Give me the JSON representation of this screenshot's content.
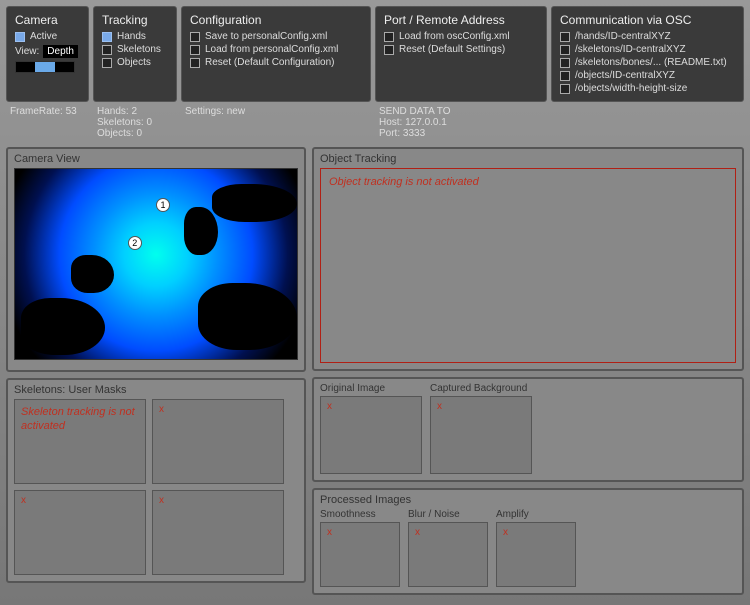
{
  "camera": {
    "title": "Camera",
    "active_label": "Active",
    "view_label": "View:",
    "view_value": "Depth",
    "framerate_label": "FrameRate:",
    "framerate_value": "53"
  },
  "tracking": {
    "title": "Tracking",
    "hands_label": "Hands",
    "skeletons_label": "Skeletons",
    "objects_label": "Objects",
    "hands_count_label": "Hands:",
    "hands_count": "2",
    "skeletons_count_label": "Skeletons:",
    "skeletons_count": "0",
    "objects_count_label": "Objects:",
    "objects_count": "0"
  },
  "configuration": {
    "title": "Configuration",
    "save_label": "Save to personalConfig.xml",
    "load_label": "Load from personalConfig.xml",
    "reset_label": "Reset (Default Configuration)",
    "settings_label": "Settings:",
    "settings_value": "new"
  },
  "port": {
    "title": "Port / Remote Address",
    "load_label": "Load from oscConfig.xml",
    "reset_label": "Reset (Default Settings)",
    "send_label": "SEND DATA TO",
    "host_label": "Host:",
    "host_value": "127.0.0.1",
    "port_label": "Port:",
    "port_value": "3333"
  },
  "communication": {
    "title": "Communication via OSC",
    "items": [
      "/hands/ID-centralXYZ",
      "/skeletons/ID-centralXYZ",
      "/skeletons/bones/... (README.txt)",
      "/objects/ID-centralXYZ",
      "/objects/width-height-size"
    ]
  },
  "camera_view": {
    "title": "Camera View",
    "marker1": "1",
    "marker2": "2"
  },
  "skeletons_section": {
    "title": "Skeletons: User Masks",
    "message": "Skeleton tracking is not activated",
    "x": "x"
  },
  "object_tracking": {
    "title": "Object Tracking",
    "message": "Object tracking is not activated"
  },
  "original_image": {
    "label": "Original Image",
    "x": "x"
  },
  "captured_bg": {
    "label": "Captured Background",
    "x": "x"
  },
  "processed": {
    "title": "Processed Images",
    "smoothness": "Smoothness",
    "blur": "Blur / Noise",
    "amplify": "Amplify",
    "x": "x"
  }
}
